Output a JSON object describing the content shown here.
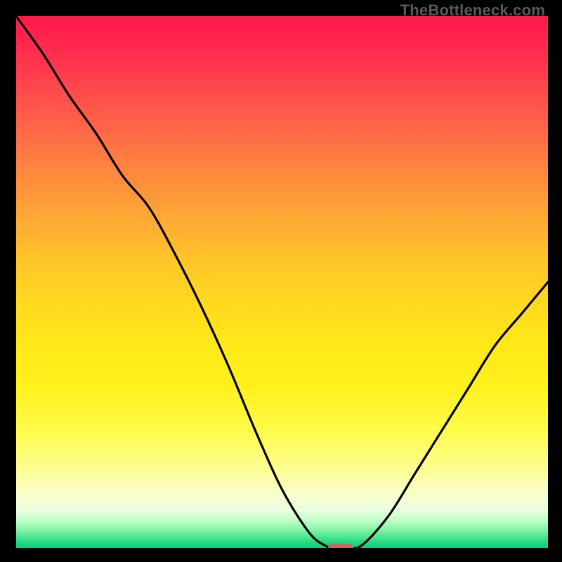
{
  "attribution": "TheBottleneck.com",
  "colors": {
    "frame": "#000000",
    "curve": "#000000",
    "marker": "#cf6561",
    "gradient_top": "#ff1a4a",
    "gradient_bottom": "#10ce7f"
  },
  "chart_data": {
    "type": "line",
    "title": "",
    "xlabel": "",
    "ylabel": "",
    "xlim": [
      0,
      100
    ],
    "ylim": [
      0,
      100
    ],
    "x": [
      0,
      5,
      10,
      15,
      20,
      25,
      30,
      35,
      40,
      45,
      50,
      55,
      58,
      60,
      62,
      65,
      70,
      75,
      80,
      85,
      90,
      95,
      100
    ],
    "y": [
      100,
      93,
      85,
      78,
      70,
      64,
      55,
      45,
      34,
      22,
      11,
      3,
      0.5,
      0,
      0,
      0.5,
      6,
      14,
      22,
      30,
      38,
      44,
      50
    ],
    "marker": {
      "x": 61,
      "y": 0
    },
    "notes": "V-shaped bottleneck curve. Minimum (0%) around x≈60–65. Left branch rises to ~100% at x=0 with a slight knee near x≈20. Right branch rises ~linearly to ~50% at x=100. Background is a vertical color gradient from red (high bottleneck) through yellow to green (no bottleneck)."
  }
}
